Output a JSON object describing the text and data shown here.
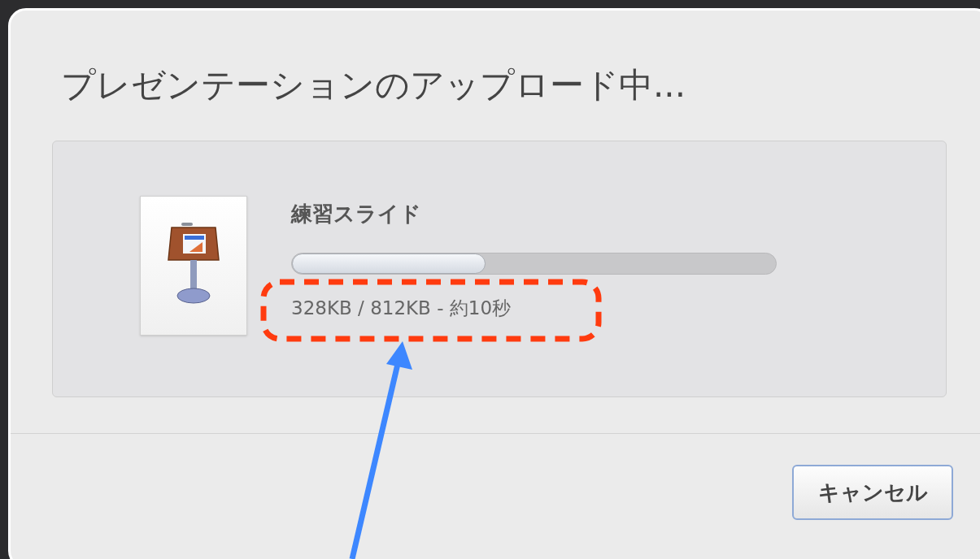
{
  "dialog": {
    "title": "プレゼンテーションのアップロード中..."
  },
  "upload": {
    "file_name": "練習スライド",
    "level": 0.4,
    "status": "328KB / 812KB - 約10秒"
  },
  "buttons": [
    {
      "label": "キャンセル",
      "kind": "cancel"
    }
  ]
}
